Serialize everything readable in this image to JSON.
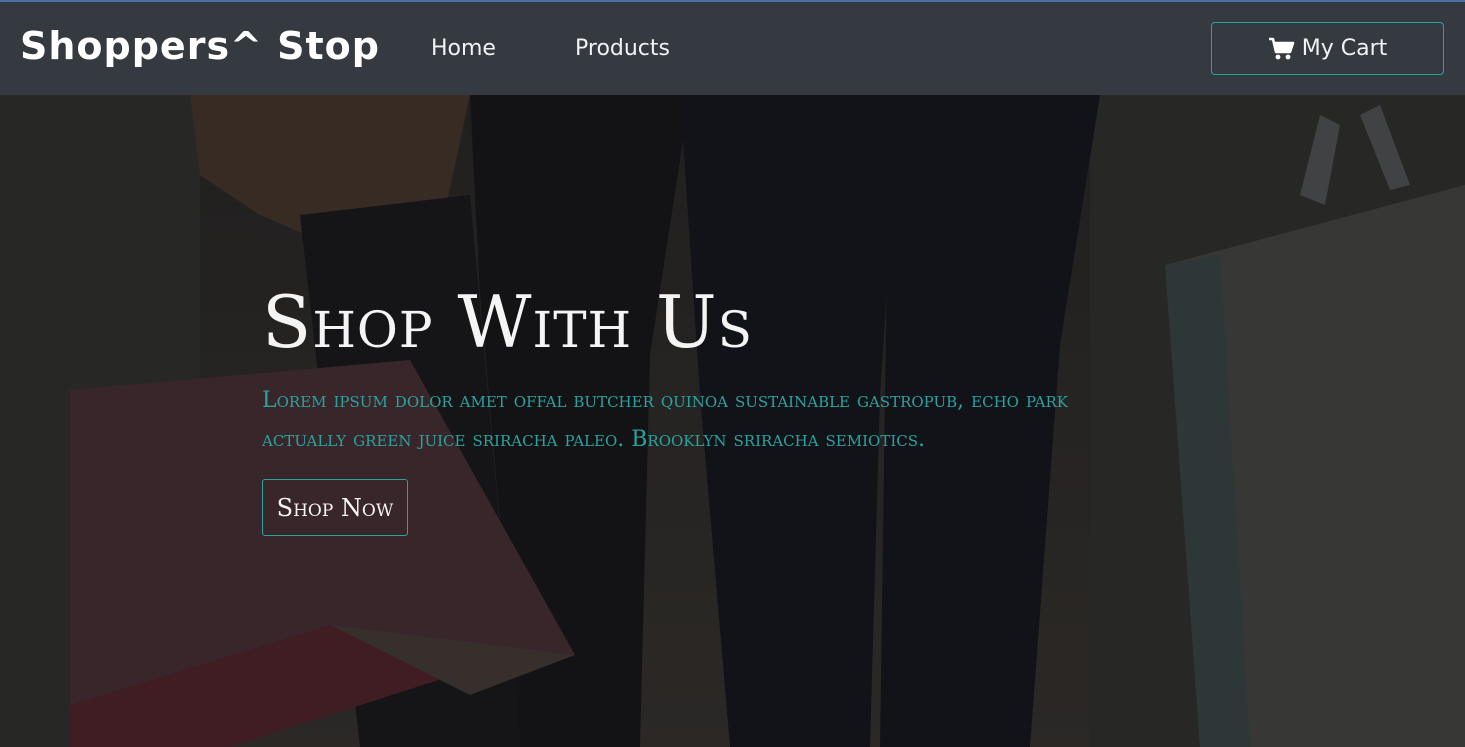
{
  "navbar": {
    "brand": "Shoppers^ Stop",
    "links": [
      {
        "label": "Home"
      },
      {
        "label": "Products"
      }
    ],
    "cart_label": "My Cart",
    "cart_icon": "shopping-cart-icon"
  },
  "hero": {
    "title": "Shop With Us",
    "description": "Lorem ipsum dolor amet offal butcher quinoa sustainable gastropub, echo park actually green juice sriracha paleo. Brooklyn sriracha semiotics.",
    "button_label": "Shop Now",
    "background_image": "people carrying shopping bags"
  },
  "colors": {
    "navbar_bg": "#343a40",
    "accent": "#2aa39e",
    "text_light": "#f4f4f4"
  }
}
